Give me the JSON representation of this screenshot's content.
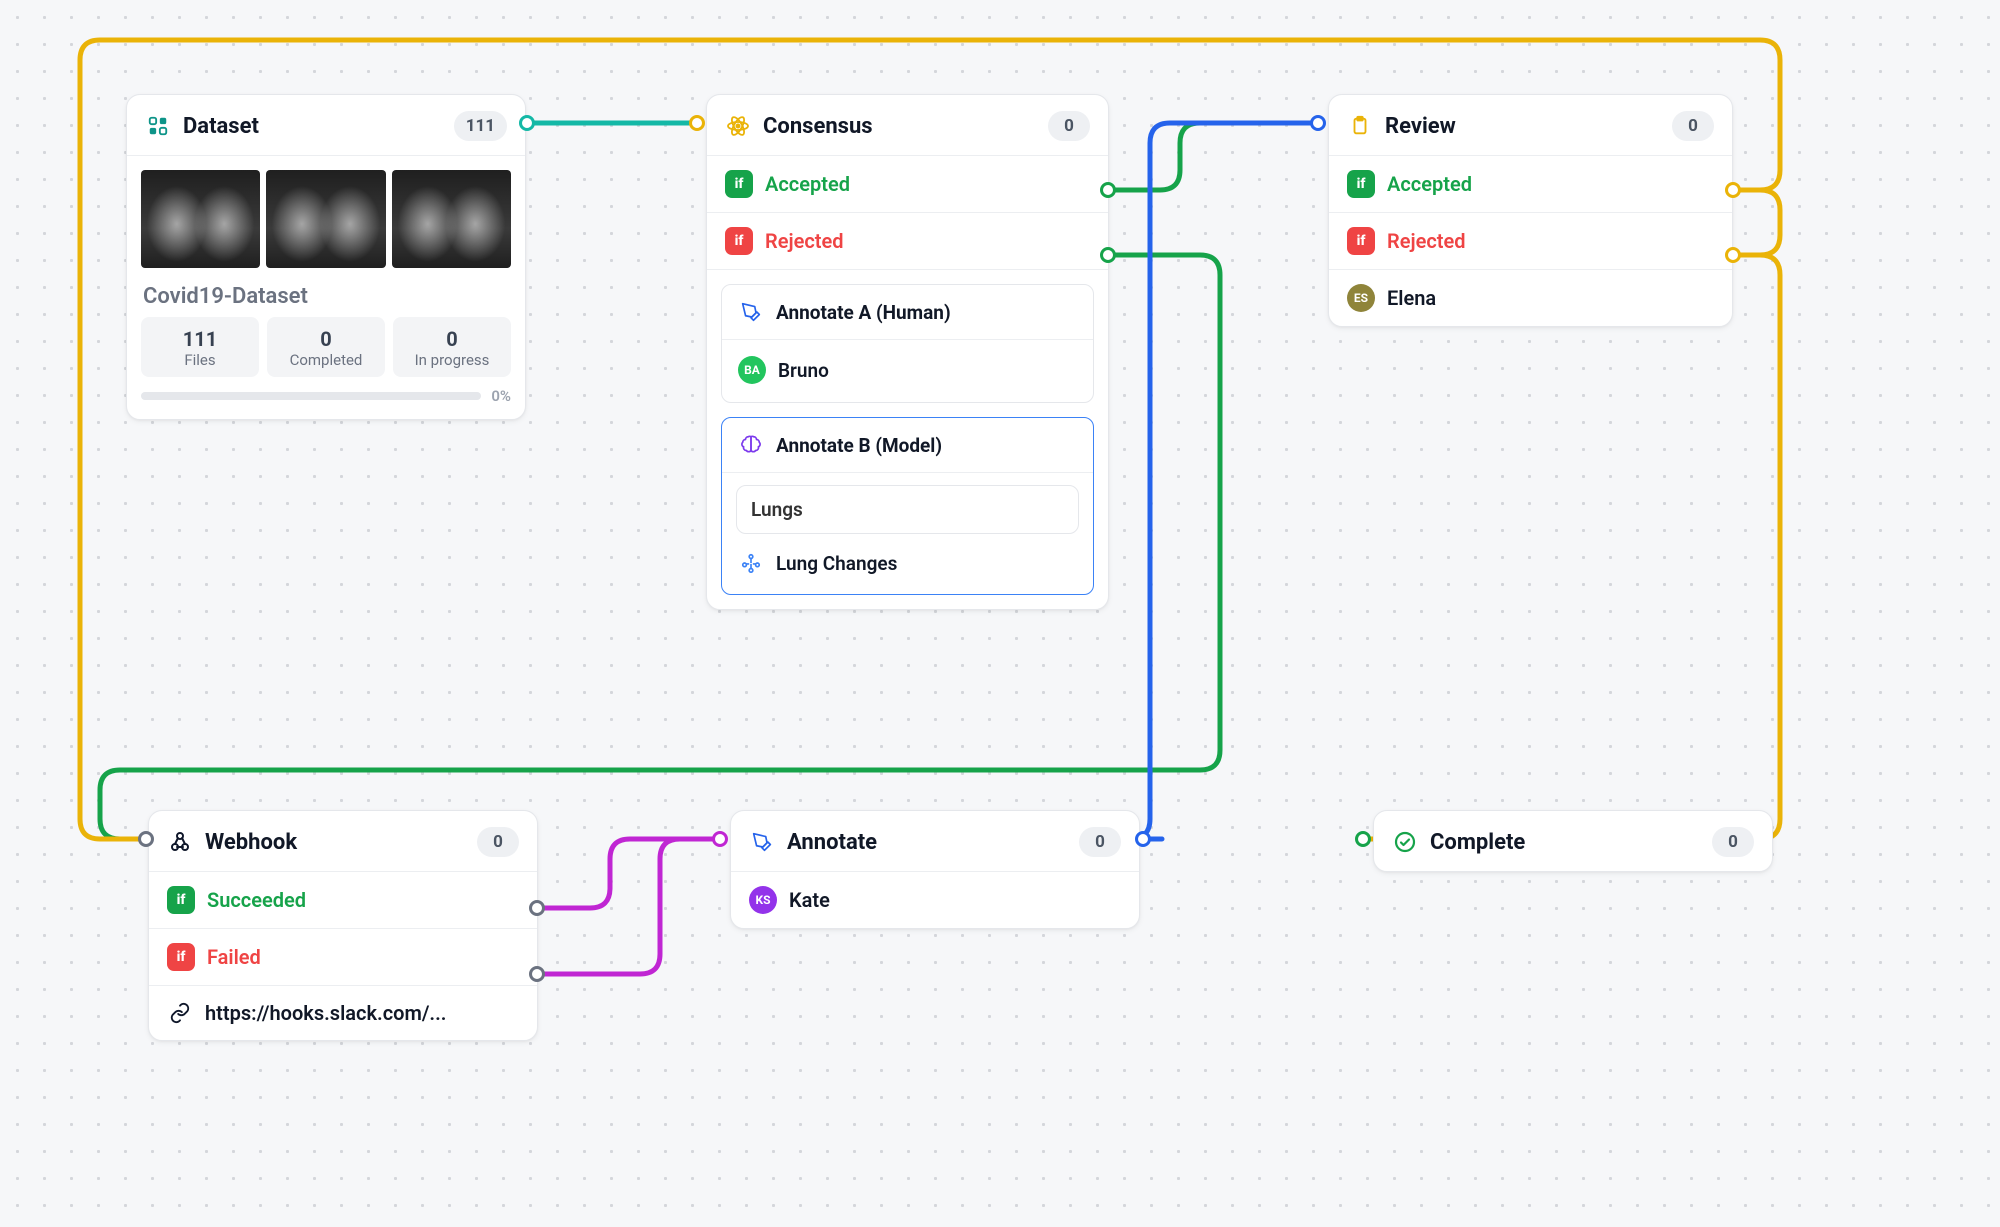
{
  "dataset": {
    "title": "Dataset",
    "count": "111",
    "name": "Covid19-Dataset",
    "stats": {
      "files": {
        "value": "111",
        "label": "Files"
      },
      "completed": {
        "value": "0",
        "label": "Completed"
      },
      "inprogress": {
        "value": "0",
        "label": "In progress"
      }
    },
    "progress_pct": "0%"
  },
  "consensus": {
    "title": "Consensus",
    "count": "0",
    "accepted_label": "Accepted",
    "rejected_label": "Rejected",
    "annotate_a": {
      "title": "Annotate A (Human)",
      "annotator": {
        "initials": "BA",
        "name": "Bruno"
      }
    },
    "annotate_b": {
      "title": "Annotate B (Model)",
      "field": "Lungs",
      "model_label": "Lung Changes"
    }
  },
  "review": {
    "title": "Review",
    "count": "0",
    "accepted_label": "Accepted",
    "rejected_label": "Rejected",
    "reviewer": {
      "initials": "ES",
      "name": "Elena"
    }
  },
  "webhook": {
    "title": "Webhook",
    "count": "0",
    "succeeded_label": "Succeeded",
    "failed_label": "Failed",
    "url": "https://hooks.slack.com/..."
  },
  "annotate": {
    "title": "Annotate",
    "count": "0",
    "annotator": {
      "initials": "KS",
      "name": "Kate"
    }
  },
  "complete": {
    "title": "Complete",
    "count": "0"
  },
  "colors": {
    "teal": "#14b8a6",
    "green": "#16a34a",
    "blue": "#2563eb",
    "amber": "#eab308",
    "magenta": "#c026d3",
    "gray": "#6b7280"
  }
}
